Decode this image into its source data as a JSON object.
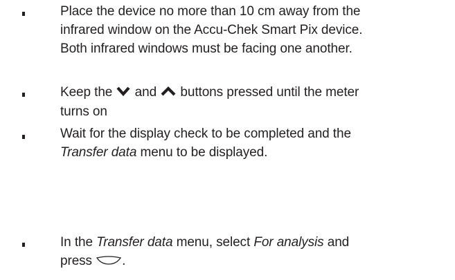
{
  "instructions": [
    {
      "line1": "Place the device no more than 10 cm away from the",
      "line2": "infrared window on the Accu-Chek Smart Pix device.",
      "line3": "Both infrared windows must be facing one another."
    },
    {
      "part1": "Keep the",
      "part2": "and",
      "part3": "buttons pressed until the meter",
      "line2": "turns on",
      "icon_down": "chevron-down-icon",
      "icon_up": "chevron-up-icon"
    },
    {
      "line1": "Wait for the display check to be completed and the",
      "line2_italic": "Transfer data",
      "line2_rest": " menu to be displayed."
    },
    {
      "part1": "In the ",
      "italic1": "Transfer data",
      "part2": " menu, select ",
      "italic2": "For analysis",
      "part3": " and",
      "line2": "press",
      "line2_end": ".",
      "icon_enter": "enter-button-icon"
    }
  ]
}
